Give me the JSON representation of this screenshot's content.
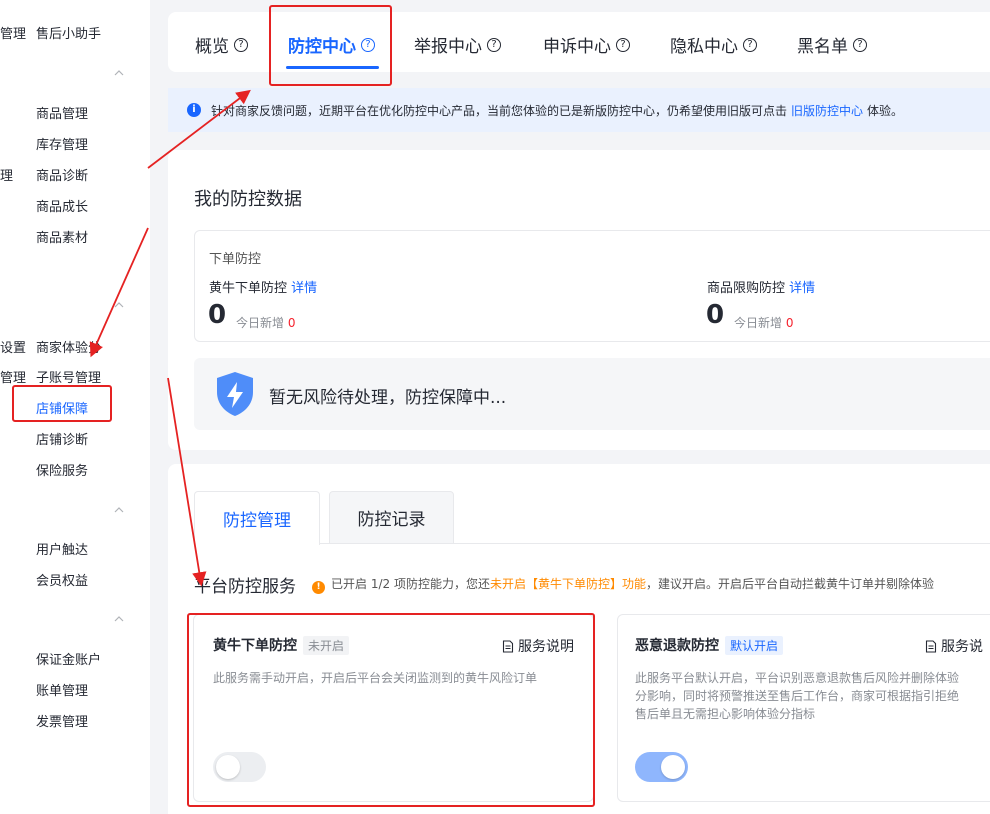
{
  "sidebar": {
    "top_left": "管理",
    "top_item": "售后小助手",
    "left_fragments": [
      "理",
      "设置",
      "管理"
    ],
    "items": [
      "商品管理",
      "库存管理",
      "商品诊断",
      "商品成长",
      "商品素材",
      "商家体验分",
      "子账号管理",
      "店铺保障",
      "店铺诊断",
      "保险服务",
      "用户触达",
      "会员权益",
      "保证金账户",
      "账单管理",
      "发票管理"
    ],
    "active_item": "店铺保障"
  },
  "tabs": [
    {
      "label": "概览"
    },
    {
      "label": "防控中心",
      "active": true
    },
    {
      "label": "举报中心"
    },
    {
      "label": "申诉中心"
    },
    {
      "label": "隐私中心"
    },
    {
      "label": "黑名单"
    }
  ],
  "notice": {
    "text_before": "针对商家反馈问题，近期平台在优化防控中心产品，当前您体验的已是新版防控中心，仍希望使用旧版可点击",
    "link": "旧版防控中心",
    "text_after": "体验。"
  },
  "data_section": {
    "title": "我的防控数据",
    "group_label": "下单防控",
    "items": [
      {
        "label": "黄牛下单防控",
        "link": "详情",
        "value": "0",
        "today_label": "今日新增",
        "today_value": "0"
      },
      {
        "label": "商品限购防控",
        "link": "详情",
        "value": "0",
        "today_label": "今日新增",
        "today_value": "0"
      }
    ],
    "status_text": "暂无风险待处理，防控保障中..."
  },
  "protect_tabs": [
    {
      "label": "防控管理",
      "active": true
    },
    {
      "label": "防控记录"
    }
  ],
  "services_section": {
    "title": "平台防控服务",
    "note_prefix": "已开启 1/2 项防控能力，您还",
    "note_highlight": "未开启【黄牛下单防控】功能",
    "note_suffix": "，建议开启。开启后平台自动拦截黄牛订单并剔除体验"
  },
  "services": [
    {
      "name": "黄牛下单防控",
      "badge": "未开启",
      "doc_label": "服务说明",
      "desc": "此服务需手动开启，开启后平台会关闭监测到的黄牛风险订单",
      "enabled": false
    },
    {
      "name": "恶意退款防控",
      "badge": "默认开启",
      "doc_label": "服务说",
      "desc_lines": [
        "此服务平台默认开启，平台识别恶意退款售后风险并删除体验",
        "分影响，同时将预警推送至售后工作台，商家可根据指引拒绝",
        "售后单且无需担心影响体验分指标"
      ],
      "enabled": true
    }
  ],
  "colors": {
    "primary": "#1966ff",
    "warning": "#ff8a00",
    "danger": "#f5222d",
    "annotation": "#e52222"
  }
}
